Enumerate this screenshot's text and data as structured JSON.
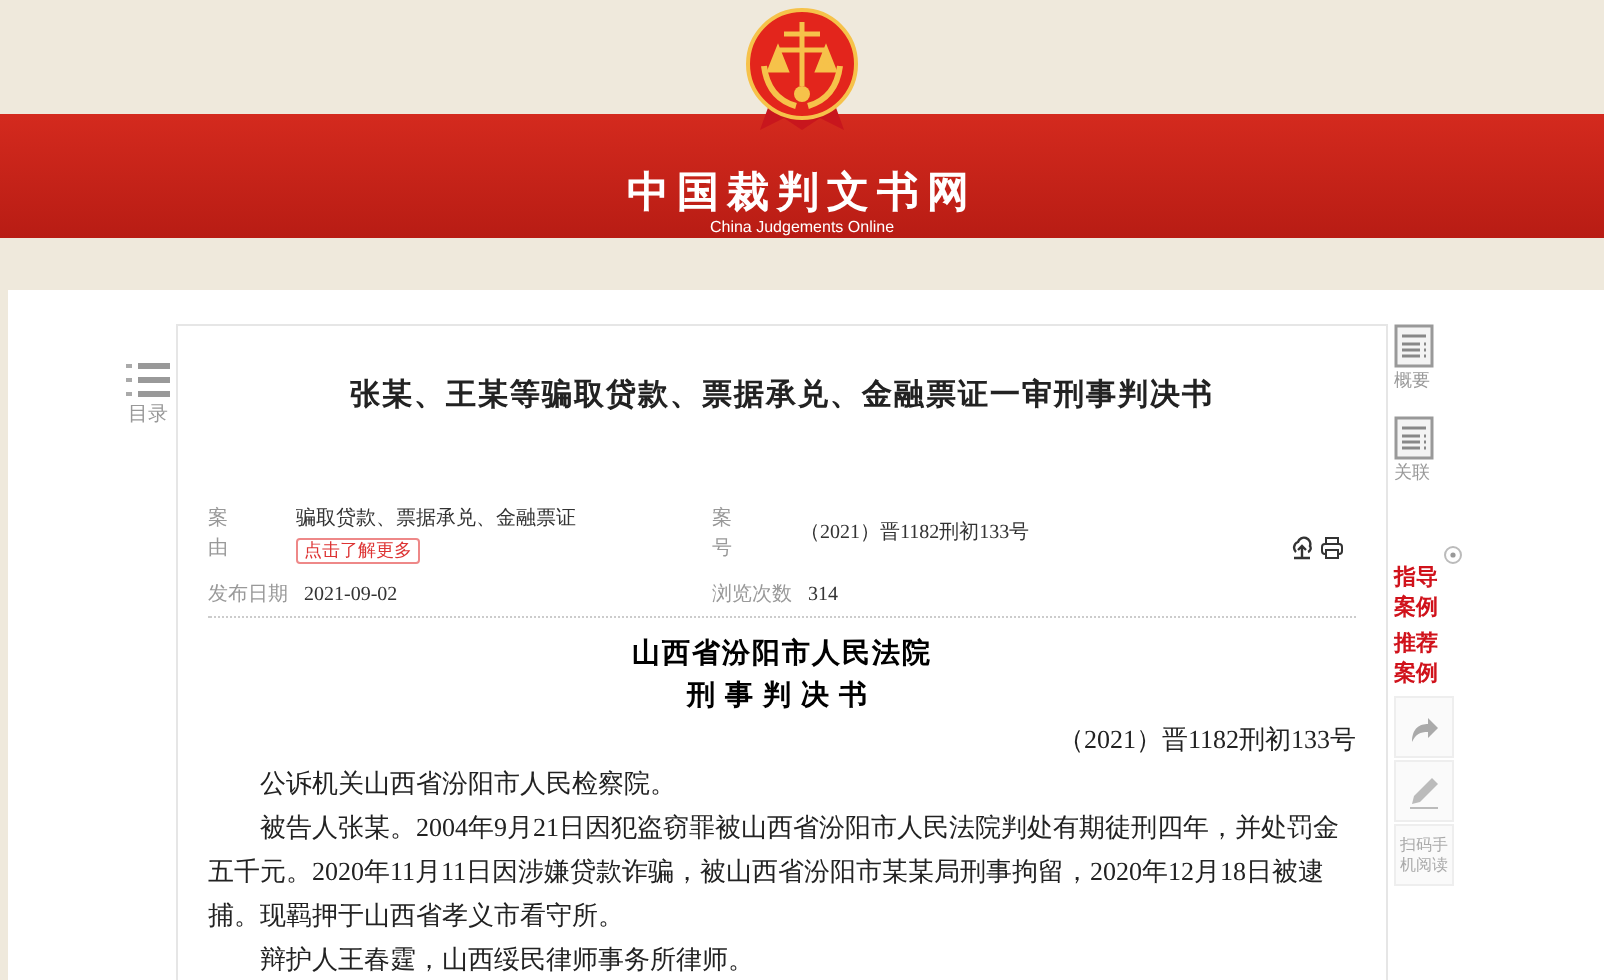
{
  "header": {
    "site_title": "中国裁判文书网",
    "site_subtitle": "China Judgements Online"
  },
  "toc": {
    "label": "目录"
  },
  "document": {
    "title": "张某、王某等骗取贷款、票据承兑、金融票证一审刑事判决书",
    "cause": {
      "label": "案由",
      "value": "骗取贷款、票据承兑、金融票证",
      "button": "点击了解更多"
    },
    "case_no": {
      "label": "案号",
      "value": "（2021）晋1182刑初133号"
    },
    "publish_date": {
      "label": "发布日期",
      "value": "2021-09-02"
    },
    "views": {
      "label": "浏览次数",
      "value": "314"
    },
    "court": "山西省汾阳市人民法院",
    "doc_type": "刑事判决书",
    "case_number": "（2021）晋1182刑初133号",
    "paragraphs": [
      "公诉机关山西省汾阳市人民检察院。",
      "被告人张某。2004年9月21日因犯盗窃罪被山西省汾阳市人民法院判处有期徒刑四年，并处罚金五千元。2020年11月11日因涉嫌贷款诈骗，被山西省汾阳市某某局刑事拘留，2020年12月18日被逮捕。现羁押于山西省孝义市看守所。",
      "辩护人王春霆，山西绥民律师事务所律师。"
    ]
  },
  "sidebar": {
    "items": [
      {
        "label": "概要"
      },
      {
        "label": "关联"
      }
    ],
    "case_links": [
      {
        "label": "指导案例"
      },
      {
        "label": "推荐案例"
      }
    ],
    "tools": [
      {
        "kind": "share"
      },
      {
        "kind": "edit"
      },
      {
        "kind": "qr",
        "label": "扫码手机阅读"
      }
    ]
  }
}
